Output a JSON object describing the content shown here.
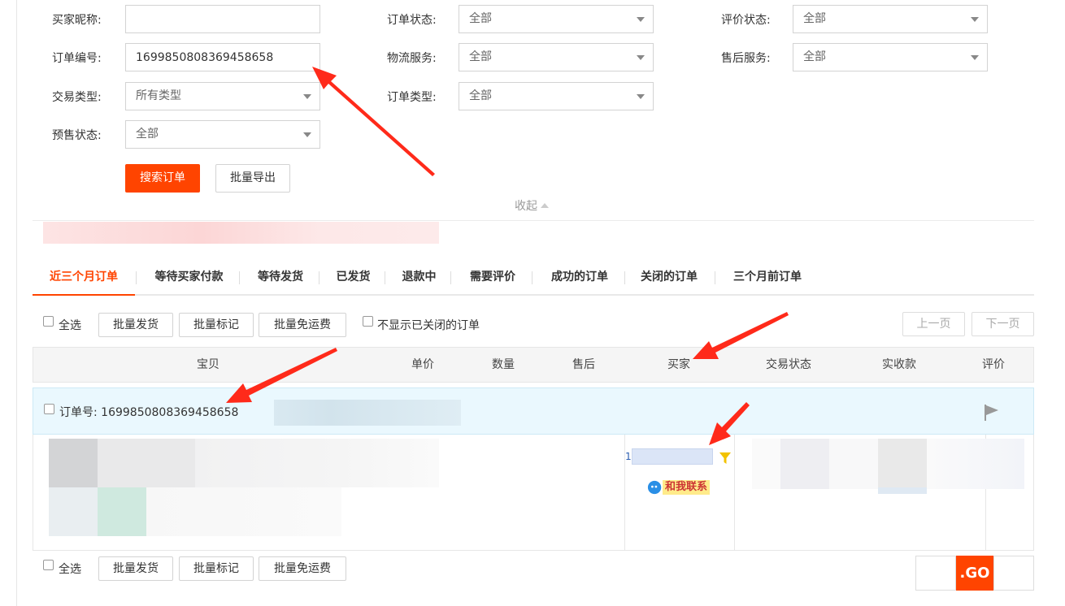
{
  "form": {
    "buyer_nick_label": "买家昵称:",
    "buyer_nick_value": "",
    "order_no_label": "订单编号:",
    "order_no_value": "1699850808369458658",
    "trade_type_label": "交易类型:",
    "trade_type_value": "所有类型",
    "presale_label": "预售状态:",
    "presale_value": "全部",
    "order_status_label": "订单状态:",
    "order_status_value": "全部",
    "logistics_label": "物流服务:",
    "logistics_value": "全部",
    "order_type_label": "订单类型:",
    "order_type_value": "全部",
    "review_status_label": "评价状态:",
    "review_status_value": "全部",
    "after_sale_label": "售后服务:",
    "after_sale_value": "全部",
    "search_button": "搜索订单",
    "export_button": "批量导出",
    "collapse_label": "收起"
  },
  "tabs": [
    {
      "label": "近三个月订单"
    },
    {
      "label": "等待买家付款"
    },
    {
      "label": "等待发货"
    },
    {
      "label": "已发货"
    },
    {
      "label": "退款中"
    },
    {
      "label": "需要评价"
    },
    {
      "label": "成功的订单"
    },
    {
      "label": "关闭的订单"
    },
    {
      "label": "三个月前订单"
    }
  ],
  "toolbar": {
    "select_all": "全选",
    "batch_ship": "批量发货",
    "batch_mark": "批量标记",
    "batch_free_shipping": "批量免运费",
    "hide_closed": "不显示已关闭的订单",
    "prev_page": "上一页",
    "next_page": "下一页"
  },
  "table": {
    "columns": [
      "宝贝",
      "单价",
      "数量",
      "售后",
      "买家",
      "交易状态",
      "实收款",
      "评价"
    ]
  },
  "order": {
    "order_no_text": "订单号: 1699850808369458658",
    "buyer_prefix": "1",
    "contact_label": "和我联系"
  },
  "watermark": {
    "text": ".GO"
  },
  "colors": {
    "accent": "#ff4400",
    "order_header_bg": "#eaf8fe",
    "arrow": "#ff2a1a"
  }
}
